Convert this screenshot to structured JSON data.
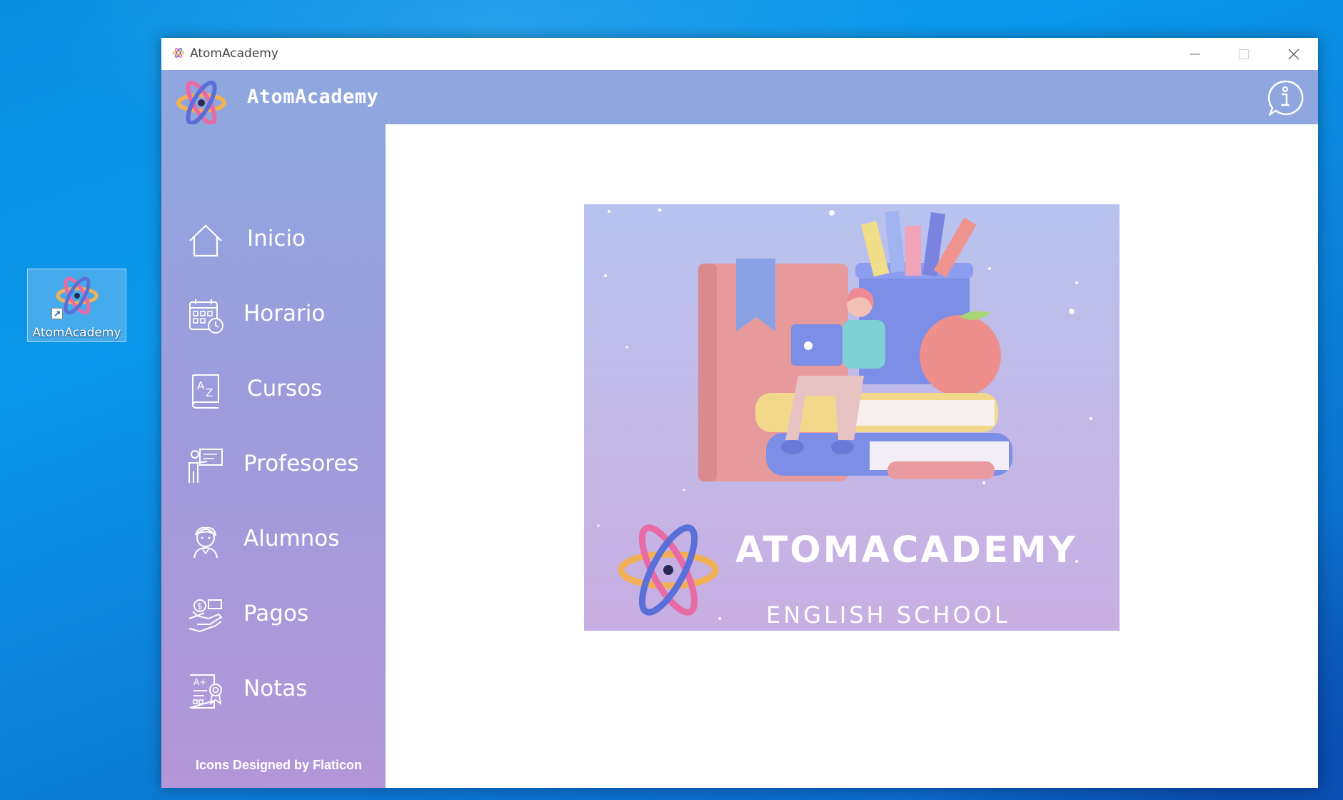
{
  "desktop": {
    "icon_label": "AtomAcademy"
  },
  "window": {
    "title": "AtomAcademy",
    "controls": [
      "minimize",
      "maximize",
      "close"
    ]
  },
  "header": {
    "app_name": "AtomAcademy",
    "info_icon": "info-icon"
  },
  "sidebar": {
    "items": [
      {
        "label": "Inicio",
        "icon": "home-icon"
      },
      {
        "label": "Horario",
        "icon": "calendar-clock-icon"
      },
      {
        "label": "Cursos",
        "icon": "dictionary-az-icon"
      },
      {
        "label": "Profesores",
        "icon": "teacher-icon"
      },
      {
        "label": "Alumnos",
        "icon": "student-icon"
      },
      {
        "label": "Pagos",
        "icon": "payment-hand-icon"
      },
      {
        "label": "Notas",
        "icon": "grades-certificate-icon"
      }
    ],
    "credit": "Icons Designed by Flaticon"
  },
  "banner": {
    "brand": "ATOMACADEMY",
    "subtitle": "ENGLISH SCHOOL"
  },
  "colors": {
    "header": "#8fa6de",
    "sidebar_top": "#8fa6de",
    "sidebar_bottom": "#b397d8",
    "accent_orange": "#f2b055",
    "accent_pink": "#e86aa6",
    "accent_blue": "#5a6fd8"
  }
}
